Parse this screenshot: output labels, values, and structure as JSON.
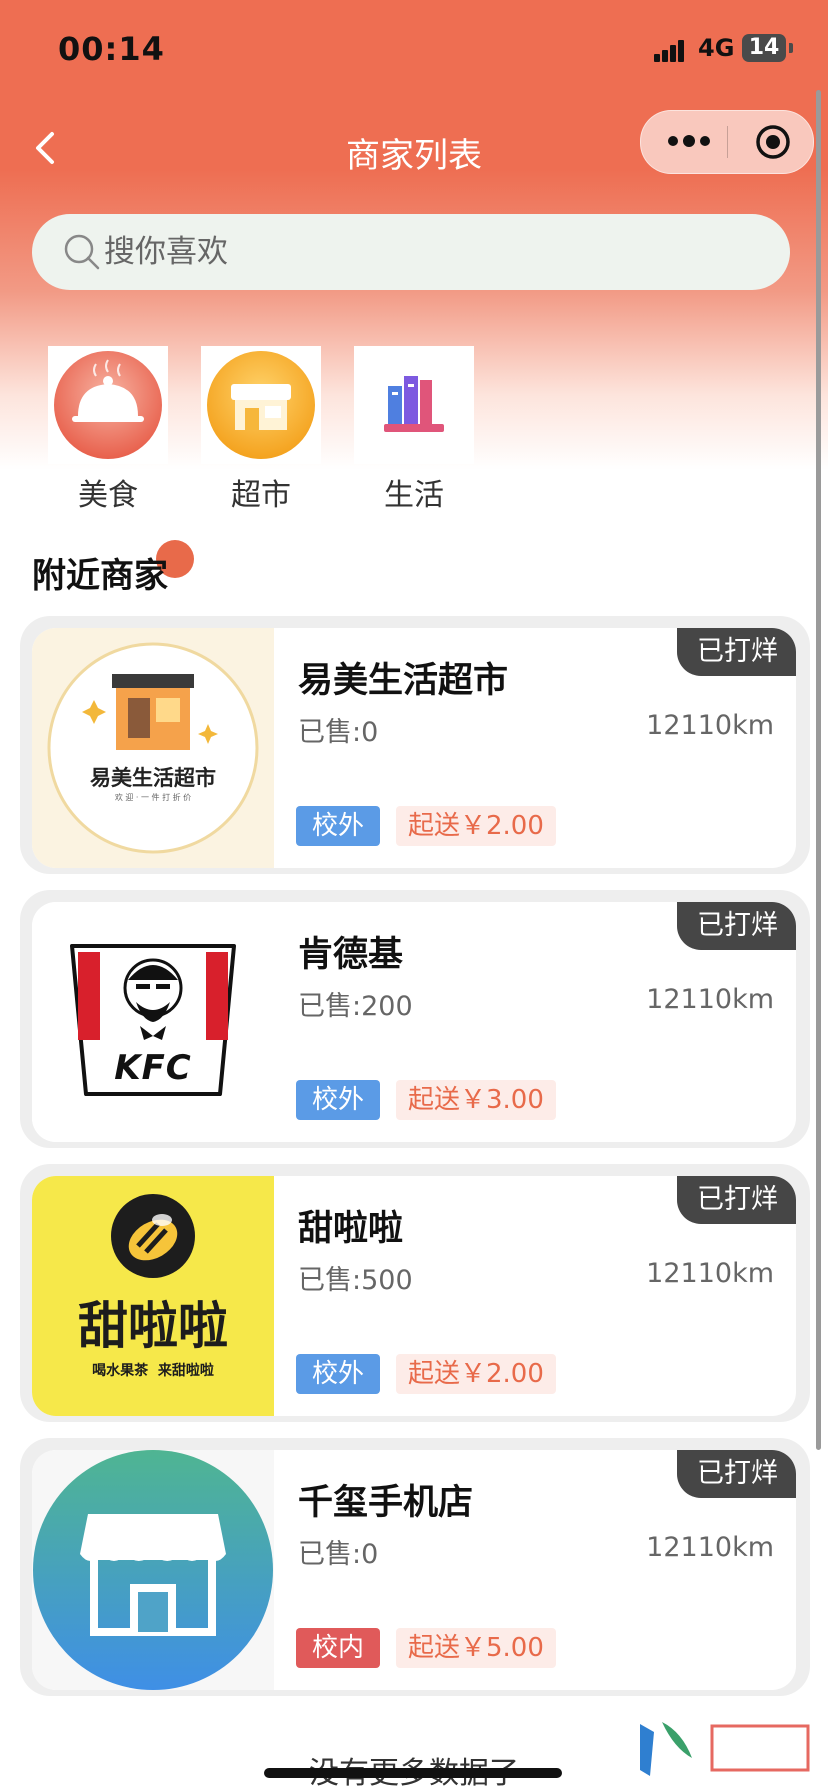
{
  "status_bar": {
    "time": "00:14",
    "network": "4G",
    "battery": "14"
  },
  "nav": {
    "title": "商家列表"
  },
  "search": {
    "placeholder": "搜你喜欢"
  },
  "categories": [
    {
      "label": "美食",
      "icon": "food-cloche-icon"
    },
    {
      "label": "超市",
      "icon": "supermarket-store-icon"
    },
    {
      "label": "生活",
      "icon": "books-life-icon"
    }
  ],
  "section": {
    "title": "附近商家"
  },
  "stores": [
    {
      "name": "易美生活超市",
      "sold": "已售:0",
      "distance": "12110km",
      "tag": "校外",
      "min_order": "起送￥2.00",
      "badge": "已打烊",
      "logo_text": "易美生活超市",
      "logo_sub": "欢 迎 · 一 件 打 折 价"
    },
    {
      "name": "肯德基",
      "sold": "已售:200",
      "distance": "12110km",
      "tag": "校外",
      "min_order": "起送￥3.00",
      "badge": "已打烊",
      "logo_text": "KFC"
    },
    {
      "name": "甜啦啦",
      "sold": "已售:500",
      "distance": "12110km",
      "tag": "校外",
      "min_order": "起送￥2.00",
      "badge": "已打烊",
      "logo_text": "甜啦啦",
      "logo_sub": "喝水果茶  来甜啦啦"
    },
    {
      "name": "千玺手机店",
      "sold": "已售:0",
      "distance": "12110km",
      "tag": "校内",
      "min_order": "起送￥5.00",
      "badge": "已打烊"
    }
  ],
  "footer": {
    "no_more": "没有更多数据了"
  },
  "colors": {
    "header": "#ee6e52",
    "tag_outside": "#5b9be6",
    "tag_inside": "#e05a5a",
    "min_order": "#e86a4a",
    "badge": "#464646"
  }
}
